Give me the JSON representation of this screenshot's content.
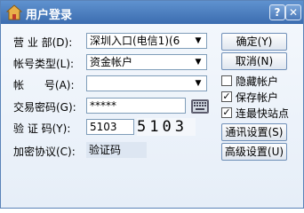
{
  "window": {
    "title": "用户登录",
    "help_label": "?",
    "close_label": "✕",
    "icon": "house-icon"
  },
  "form": {
    "department_label": "营 业 部(D):",
    "department_value": "深圳入口(电信1)(6",
    "account_type_label": "帐号类型(L):",
    "account_type_value": "资金帐户",
    "account_label": "帐      号(A):",
    "account_value": "",
    "password_label": "交易密码(G):",
    "password_value": "*****",
    "captcha_label": "验 证 码(Y):",
    "captcha_value": "5103",
    "captcha_image": "5103",
    "encryption_label": "加密协议(C):",
    "encryption_value": "验证码"
  },
  "buttons": {
    "ok": "确定(Y)",
    "cancel": "取消(N)",
    "comm_settings": "通讯设置(S)",
    "advanced_settings": "高级设置(U)"
  },
  "options": {
    "hide_account": {
      "label": "隐藏帐户",
      "checked": false
    },
    "save_account": {
      "label": "保存帐户",
      "checked": true
    },
    "fastest_site": {
      "label": "连最快站点",
      "checked": true
    }
  },
  "colors": {
    "title_bar": "#3c6db0",
    "background": "#eaf0f8"
  }
}
